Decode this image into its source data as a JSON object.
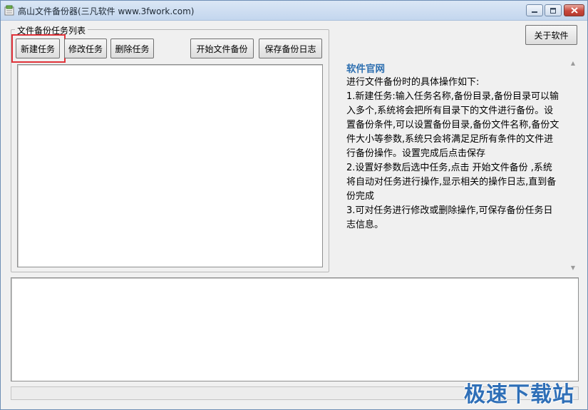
{
  "window": {
    "title": "高山文件备份器(三凡软件 www.3fwork.com)"
  },
  "toolbar": {
    "new_task": "新建任务",
    "edit_task": "修改任务",
    "delete_task": "删除任务",
    "start_backup": "开始文件备份",
    "save_log": "保存备份日志",
    "about": "关于软件"
  },
  "task_group": {
    "legend": "文件备份任务列表"
  },
  "info": {
    "heading": "软件官网",
    "body": "进行文件备份时的具体操作如下:\n1.新建任务:输入任务名称,备份目录,备份目录可以输入多个,系统将会把所有目录下的文件进行备份。设置备份条件,可以设置备份目录,备份文件名称,备份文件大小等参数,系统只会将满足足所有条件的文件进行备份操作。设置完成后点击保存\n2.设置好参数后选中任务,点击 开始文件备份 ,系统将自动对任务进行操作,显示相关的操作日志,直到备份完成\n3.可对任务进行修改或删除操作,可保存备份任务日志信息。"
  },
  "watermark": {
    "text": "极速下载站"
  },
  "colors": {
    "accent": "#2d6fb0",
    "highlight": "#e0333a"
  }
}
